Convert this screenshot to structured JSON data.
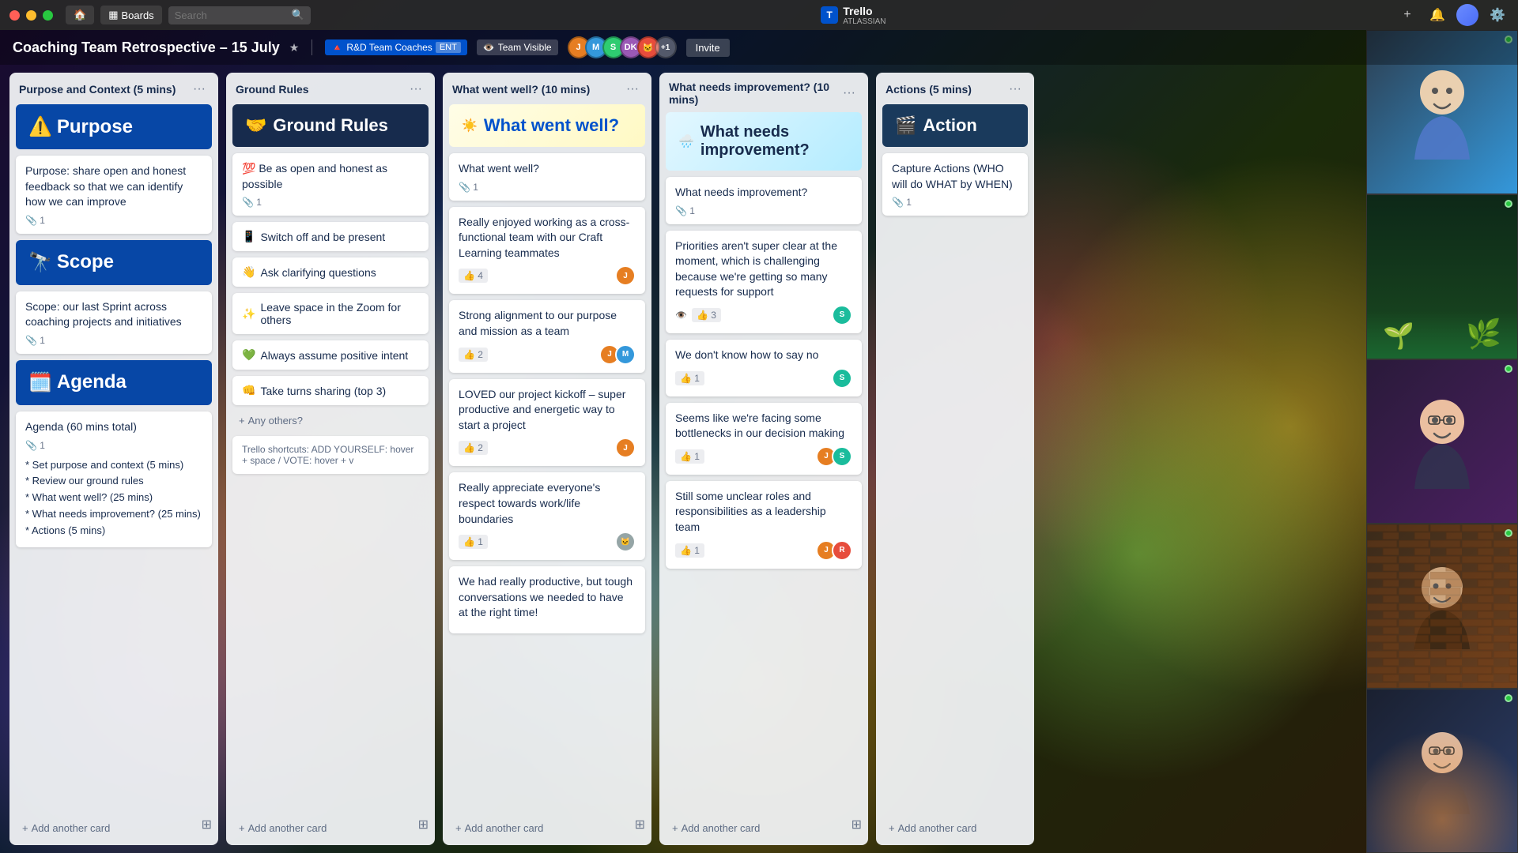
{
  "titlebar": {
    "boards_label": "Boards",
    "trello_label": "Trello",
    "atlassian_label": "ATLASSIAN",
    "new_btn": "+",
    "notification_icon": "🔔"
  },
  "header": {
    "board_title": "Coaching Team Retrospective – 15 July",
    "star_icon": "★",
    "tag_rnd": "R&D Team Coaches",
    "tag_ent": "ENT",
    "tag_visible": "Team Visible",
    "avatar_plus": "+1",
    "invite_btn": "Invite"
  },
  "columns": [
    {
      "id": "purpose",
      "title": "Purpose and Context (5 mins)",
      "cards": [
        {
          "type": "header",
          "style": "blue",
          "emoji": "⚠️",
          "title": "Purpose"
        },
        {
          "type": "text",
          "text": "Purpose: share open and honest feedback so that we can identify how we can improve",
          "attachments": 1
        },
        {
          "type": "header",
          "style": "blue",
          "emoji": "🔭",
          "title": "Scope"
        },
        {
          "type": "text",
          "text": "Scope: our last Sprint across coaching projects and initiatives",
          "attachments": 1
        },
        {
          "type": "header",
          "style": "blue",
          "emoji": "🗓️",
          "title": "Agenda"
        },
        {
          "type": "text",
          "text": "Agenda (60 mins total)",
          "attachments": 1,
          "subitems": [
            "* Set purpose and context (5 mins)",
            "* Review our ground rules",
            "* What went well? (25 mins)",
            "* What needs improvement? (25 mins)",
            "* Actions (5 mins)"
          ]
        }
      ],
      "add_card": "+ Add another card"
    },
    {
      "id": "ground-rules",
      "title": "Ground Rules",
      "header_card": {
        "emoji": "🤝",
        "title": "Ground Rules"
      },
      "items": [
        {
          "emoji": "💯",
          "text": "Be as open and honest as possible",
          "attachments": 1
        },
        {
          "emoji": "📱",
          "text": "Switch off and be present"
        },
        {
          "emoji": "👋",
          "text": "Ask clarifying questions"
        },
        {
          "emoji": "✨",
          "text": "Leave space in the Zoom for others"
        },
        {
          "emoji": "💚",
          "text": "Always assume positive intent"
        },
        {
          "emoji": "👊",
          "text": "Take turns sharing (top 3)"
        }
      ],
      "others": "+ Any others?",
      "shortcut": "Trello shortcuts: ADD YOURSELF: hover + space / VOTE: hover + v",
      "add_card": "+ Add another card"
    },
    {
      "id": "what-went-well",
      "title": "What went well? (10 mins)",
      "header_card": {
        "emoji": "☀️",
        "title": "What went well?"
      },
      "cards": [
        {
          "text": "What went well?",
          "attachments": 1
        },
        {
          "text": "Really enjoyed working as a cross-functional team with our Craft Learning teammates",
          "votes": 4,
          "avatar": "ca-orange"
        },
        {
          "text": "Strong alignment to our purpose and mission as a team",
          "votes": 2,
          "avatars": [
            "ca-orange",
            "ca-blue"
          ]
        },
        {
          "text": "LOVED our project kickoff – super productive and energetic way to start a project",
          "votes": 2,
          "avatar": "ca-orange"
        },
        {
          "text": "Really appreciate everyone's respect towards work/life boundaries",
          "votes": 1,
          "avatar": "ca-gray"
        },
        {
          "text": "We had really productive, but tough conversations we needed to have at the right time!"
        }
      ],
      "add_card": "+ Add another card"
    },
    {
      "id": "needs-improvement",
      "title": "What needs improvement? (10 mins)",
      "header_card": {
        "emoji": "🌧️",
        "title": "What needs improvement?"
      },
      "cards": [
        {
          "text": "What needs improvement?",
          "attachments": 1
        },
        {
          "text": "Priorities aren't super clear at the moment, which is challenging because we're getting so many requests for support",
          "votes": 3,
          "eye": true,
          "avatar": "ca-teal"
        },
        {
          "text": "We don't know how to say no",
          "votes": 1,
          "avatar": "ca-teal"
        },
        {
          "text": "Seems like we're facing some bottlenecks in our decision making",
          "votes": 1,
          "avatars": [
            "ca-orange",
            "ca-teal"
          ]
        },
        {
          "text": "Still some unclear roles and responsibilities as a leadership team",
          "votes": 1,
          "avatars": [
            "ca-orange",
            "ca-red"
          ]
        }
      ],
      "add_card": "+ Add another card"
    },
    {
      "id": "actions",
      "title": "Actions (5 mins)",
      "header_card": {
        "emoji": "🎬",
        "title": "Actions"
      },
      "cards": [
        {
          "text": "Capture Actions (WHO will do WHAT by WHEN)",
          "attachments": 1
        }
      ],
      "add_card": "+ Add another card"
    }
  ],
  "video": {
    "slots": [
      {
        "bg": "slot-1",
        "initials": "😊"
      },
      {
        "bg": "slot-2",
        "initials": "🌿"
      },
      {
        "bg": "slot-3",
        "initials": "😄"
      },
      {
        "bg": "slot-4",
        "initials": "👨"
      },
      {
        "bg": "slot-5",
        "initials": "👩"
      }
    ]
  }
}
